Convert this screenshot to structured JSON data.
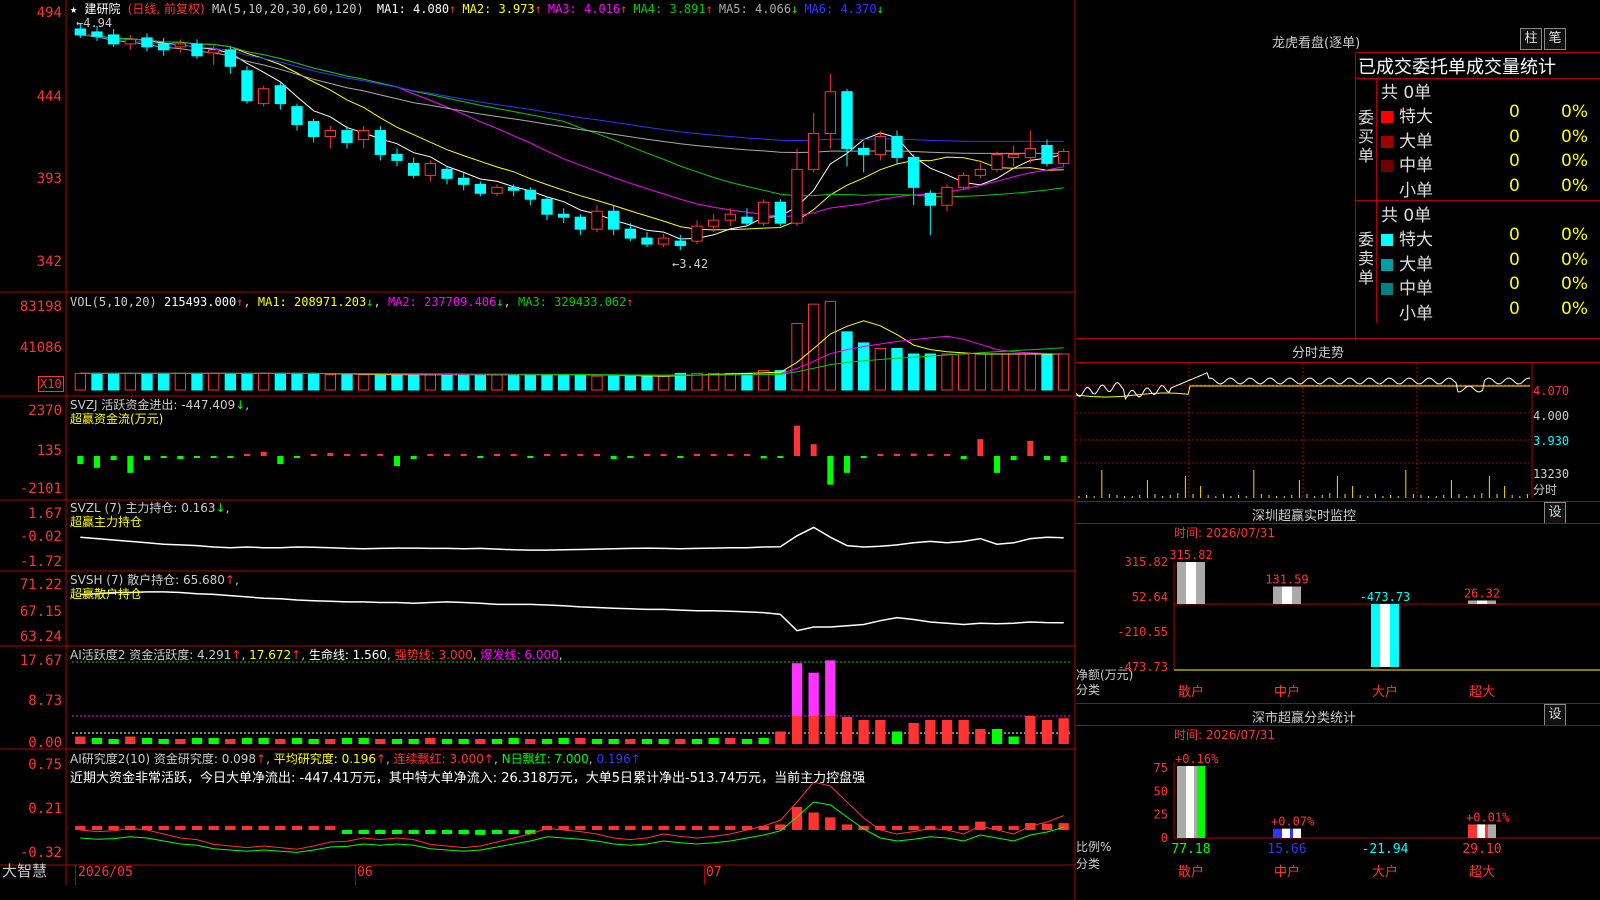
{
  "stock": {
    "name": "建研院",
    "period_note": "(日线, 前复权)"
  },
  "colors": {
    "up": "#ff3333",
    "down": "#00ffff",
    "ma1": "#ffffff",
    "ma2": "#ffff00",
    "ma3": "#ff00ff",
    "ma4": "#00cc00",
    "ma5": "#aaaaaa",
    "ma6": "#3333ff",
    "border": "#b00000",
    "green_bar": "#00ff00",
    "gold": "#ffd700"
  },
  "main_panel": {
    "ma_header": "MA(5,10,20,30,60,120)",
    "ma_values": [
      {
        "label": "MA1: 4.080",
        "arrow": "↑",
        "color": "#ffffff"
      },
      {
        "label": "MA2: 3.973",
        "arrow": "↑",
        "color": "#ffff00"
      },
      {
        "label": "MA3: 4.016",
        "arrow": "↑",
        "color": "#ff00ff"
      },
      {
        "label": "MA4: 3.891",
        "arrow": "↑",
        "color": "#00cc00"
      },
      {
        "label": "MA5: 4.066",
        "arrow": "↓",
        "color": "#aaaaaa"
      },
      {
        "label": "MA6: 4.370",
        "arrow": "↓",
        "color": "#3333ff"
      }
    ],
    "y_ticks": [
      "494",
      "444",
      "393",
      "342"
    ],
    "high_label": "4.94",
    "low_label": "3.42"
  },
  "vol_panel": {
    "header": "VOL(5,10,20)",
    "value": "215493.000",
    "ma1": "MA1: 208971.203",
    "ma2": "MA2: 237709.406",
    "ma3": "MA3: 329433.062",
    "y_ticks": [
      "83198",
      "41086"
    ],
    "unit": "X10"
  },
  "svzj_panel": {
    "header": "SVZJ  活跃资金进出: -447.409",
    "subtitle": "超赢资金流(万元)",
    "y_ticks": [
      "2370",
      "135",
      "-2101"
    ]
  },
  "svzl_panel": {
    "header": "SVZL (7) 主力持仓: 0.163",
    "subtitle": "超赢主力持仓",
    "y_ticks": [
      "1.67",
      "-0.02",
      "-1.72"
    ]
  },
  "svsh_panel": {
    "header": "SVSH (7) 散户持仓: 65.680",
    "subtitle": "超赢散户持仓",
    "y_ticks": [
      "71.22",
      "67.15",
      "63.24"
    ]
  },
  "ai1_panel": {
    "header_a": "AI活跃度2 资金活跃度: 4.291",
    "header_b": "17.672",
    "header_c": "生命线: 1.560",
    "header_d": "强势线: 3.000",
    "header_e": "爆发线: 6.000",
    "y_ticks": [
      "17.67",
      "8.73",
      "0.00"
    ]
  },
  "ai2_panel": {
    "header_a": "AI研究度2(10) 资金研究度: 0.098",
    "header_b": "平均研究度: 0.196",
    "header_c": "连续飘红: 3.000",
    "header_d": "N日飘红: 7.000",
    "header_e": "0.196",
    "note": "近期大资金非常活跃，今日大单净流出: -447.41万元，其中特大单净流入: 26.318万元，大单5日累计净出-513.74万元，当前主力控盘强",
    "y_ticks": [
      "0.75",
      "0.21",
      "-0.32"
    ]
  },
  "x_axis": {
    "labels": [
      "2026/05",
      "06",
      "07"
    ],
    "brand": "大智慧"
  },
  "dragon_tiger": {
    "title": "龙虎看盘(逐单)",
    "tab1": "柱",
    "tab2": "笔",
    "section_title": "已成交委托单成交量统计",
    "buy_label": "委买单",
    "sell_label": "委卖单",
    "buy_total": "共 0单",
    "sell_total": "共 0单",
    "buy_rows": [
      {
        "label": "特大",
        "count": "0",
        "pct": "0%",
        "color": "#ff0000"
      },
      {
        "label": "大单",
        "count": "0",
        "pct": "0%",
        "color": "#a00000"
      },
      {
        "label": "中单",
        "count": "0",
        "pct": "0%",
        "color": "#700000"
      },
      {
        "label": "小单",
        "count": "0",
        "pct": "0%",
        "color": ""
      }
    ],
    "sell_rows": [
      {
        "label": "特大",
        "count": "0",
        "pct": "0%",
        "color": "#00ffff"
      },
      {
        "label": "大单",
        "count": "0",
        "pct": "0%",
        "color": "#00a0a0"
      },
      {
        "label": "中单",
        "count": "0",
        "pct": "0%",
        "color": "#008080"
      },
      {
        "label": "小单",
        "count": "0",
        "pct": "0%",
        "color": ""
      }
    ]
  },
  "intraday": {
    "title": "分时走势",
    "y_labels": [
      "4.070",
      "4.000",
      "3.930"
    ],
    "vol_label": "13230",
    "vol_unit": "分时"
  },
  "sz_monitor": {
    "title": "深圳超赢实时监控",
    "settings": "设",
    "time": "时间: 2026/07/31",
    "y_ticks": [
      "315.82",
      "52.64",
      "-210.55",
      "-473.73"
    ],
    "y_axis_title": "净额(万元)",
    "x_axis_title": "分类",
    "categories": [
      "散户",
      "中户",
      "大户",
      "超大"
    ],
    "values": [
      315.82,
      131.59,
      -473.73,
      26.32
    ],
    "value_labels": [
      "315.82",
      "131.59",
      "-473.73",
      "26.32"
    ]
  },
  "sz_stats": {
    "title": "深市超赢分类统计",
    "settings": "设",
    "time": "时间: 2026/07/31",
    "y_ticks": [
      "75",
      "50",
      "25",
      "0"
    ],
    "y_axis_title": "比例%",
    "x_axis_title": "分类",
    "categories": [
      "散户",
      "中户",
      "大户",
      "超大"
    ],
    "pct_labels": [
      "+0.16%",
      "+0.07%",
      "",
      "+0.01%"
    ],
    "bar_values": [
      77.18,
      15.66,
      0,
      29.1
    ],
    "bottom_values": [
      "77.18",
      "15.66",
      "-21.94",
      "29.10"
    ]
  },
  "chart_data": [
    {
      "type": "candlestick",
      "title": "建研院 (日线, 前复权)",
      "ylim": [
        3.3,
        5.0
      ],
      "candles": [
        [
          4.9,
          4.86,
          4.94,
          4.84
        ],
        [
          4.88,
          4.85,
          4.92,
          4.82
        ],
        [
          4.86,
          4.8,
          4.9,
          4.78
        ],
        [
          4.8,
          4.83,
          4.86,
          4.76
        ],
        [
          4.84,
          4.78,
          4.87,
          4.75
        ],
        [
          4.8,
          4.76,
          4.84,
          4.72
        ],
        [
          4.78,
          4.8,
          4.83,
          4.74
        ],
        [
          4.8,
          4.72,
          4.83,
          4.7
        ],
        [
          4.74,
          4.76,
          4.79,
          4.66
        ],
        [
          4.76,
          4.65,
          4.78,
          4.6
        ],
        [
          4.62,
          4.42,
          4.65,
          4.4
        ],
        [
          4.4,
          4.5,
          4.52,
          4.38
        ],
        [
          4.52,
          4.4,
          4.54,
          4.36
        ],
        [
          4.38,
          4.26,
          4.4,
          4.22
        ],
        [
          4.28,
          4.18,
          4.3,
          4.14
        ],
        [
          4.18,
          4.22,
          4.25,
          4.1
        ],
        [
          4.22,
          4.14,
          4.25,
          4.1
        ],
        [
          4.16,
          4.22,
          4.25,
          4.1
        ],
        [
          4.22,
          4.06,
          4.25,
          4.02
        ],
        [
          4.06,
          4.02,
          4.1,
          3.98
        ],
        [
          4.0,
          3.92,
          4.04,
          3.9
        ],
        [
          3.92,
          4.0,
          4.02,
          3.88
        ],
        [
          3.96,
          3.9,
          3.98,
          3.86
        ],
        [
          3.9,
          3.86,
          3.94,
          3.82
        ],
        [
          3.86,
          3.8,
          3.88,
          3.78
        ],
        [
          3.8,
          3.84,
          3.86,
          3.78
        ],
        [
          3.84,
          3.82,
          3.86,
          3.78
        ],
        [
          3.82,
          3.76,
          3.84,
          3.72
        ],
        [
          3.76,
          3.66,
          3.78,
          3.62
        ],
        [
          3.66,
          3.64,
          3.7,
          3.6
        ],
        [
          3.64,
          3.56,
          3.66,
          3.52
        ],
        [
          3.56,
          3.68,
          3.72,
          3.54
        ],
        [
          3.68,
          3.56,
          3.72,
          3.52
        ],
        [
          3.56,
          3.5,
          3.6,
          3.48
        ],
        [
          3.5,
          3.46,
          3.54,
          3.44
        ],
        [
          3.46,
          3.5,
          3.53,
          3.44
        ],
        [
          3.48,
          3.45,
          3.52,
          3.42
        ],
        [
          3.48,
          3.58,
          3.62,
          3.46
        ],
        [
          3.58,
          3.62,
          3.66,
          3.54
        ],
        [
          3.62,
          3.66,
          3.7,
          3.58
        ],
        [
          3.64,
          3.6,
          3.7,
          3.58
        ],
        [
          3.6,
          3.74,
          3.76,
          3.58
        ],
        [
          3.74,
          3.6,
          3.76,
          3.58
        ],
        [
          3.6,
          3.96,
          4.1,
          3.58
        ],
        [
          3.96,
          4.2,
          4.34,
          3.94
        ],
        [
          4.2,
          4.48,
          4.6,
          4.1
        ],
        [
          4.48,
          4.1,
          4.5,
          3.98
        ],
        [
          4.1,
          4.06,
          4.14,
          3.94
        ],
        [
          4.06,
          4.18,
          4.22,
          4.02
        ],
        [
          4.18,
          4.04,
          4.22,
          4.0
        ],
        [
          4.04,
          3.84,
          4.06,
          3.72
        ],
        [
          3.8,
          3.72,
          3.82,
          3.52
        ],
        [
          3.72,
          3.84,
          3.86,
          3.68
        ],
        [
          3.84,
          3.92,
          3.94,
          3.82
        ],
        [
          3.92,
          3.96,
          4.0,
          3.9
        ],
        [
          3.96,
          4.06,
          4.08,
          3.94
        ],
        [
          4.04,
          4.06,
          4.12,
          3.98
        ],
        [
          4.04,
          4.1,
          4.22,
          4.0
        ],
        [
          4.12,
          4.0,
          4.16,
          3.98
        ],
        [
          4.0,
          4.08,
          4.1,
          3.98
        ]
      ],
      "ma_series": {
        "MA1": 4.08,
        "MA2": 3.973,
        "MA3": 4.016,
        "MA4": 3.891,
        "MA5": 4.066,
        "MA6": 4.37
      }
    },
    {
      "type": "bar",
      "title": "VOL(5,10,20)",
      "ylim": [
        0,
        83198
      ],
      "values": [
        12,
        12,
        12,
        12,
        12,
        12,
        12,
        12,
        12,
        12,
        12,
        12,
        12,
        12,
        12,
        11,
        11,
        11,
        11,
        11,
        11,
        11,
        11,
        11,
        11,
        11,
        11,
        11,
        11,
        11,
        11,
        10,
        10,
        10,
        10,
        10,
        12,
        12,
        12,
        12,
        12,
        14,
        14,
        48,
        62,
        64,
        42,
        34,
        30,
        30,
        26,
        26,
        26,
        26,
        26,
        26,
        26,
        26,
        26,
        26
      ],
      "up": [
        1,
        0,
        0,
        1,
        0,
        0,
        1,
        0,
        1,
        0,
        0,
        1,
        0,
        0,
        0,
        1,
        0,
        1,
        0,
        0,
        0,
        1,
        0,
        0,
        0,
        1,
        0,
        0,
        0,
        0,
        0,
        1,
        0,
        0,
        0,
        1,
        0,
        1,
        1,
        1,
        0,
        1,
        0,
        1,
        1,
        1,
        0,
        0,
        1,
        0,
        0,
        0,
        1,
        1,
        1,
        1,
        1,
        1,
        0,
        1
      ],
      "series": [
        {
          "name": "MA1",
          "last": 208971.203
        },
        {
          "name": "MA2",
          "last": 237709.406
        },
        {
          "name": "MA3",
          "last": 329433.062
        }
      ]
    },
    {
      "type": "bar",
      "title": "超赢资金流(万元)",
      "ylim": [
        -2101,
        2370
      ],
      "values": [
        -400,
        -700,
        -200,
        -1000,
        -200,
        -100,
        -150,
        -100,
        -50,
        -50,
        80,
        200,
        -400,
        -100,
        100,
        150,
        80,
        30,
        50,
        -500,
        -150,
        80,
        50,
        30,
        -50,
        100,
        80,
        -100,
        60,
        70,
        100,
        60,
        -150,
        -100,
        80,
        60,
        -80,
        50,
        60,
        50,
        30,
        -120,
        -80,
        1800,
        700,
        -1700,
        -1000,
        -100,
        60,
        80,
        120,
        100,
        80,
        -150,
        1000,
        -1000,
        -200,
        900,
        -200,
        -300
      ]
    },
    {
      "type": "line",
      "title": "超赢主力持仓",
      "ylim": [
        -1.72,
        1.67
      ],
      "values": [
        0.2,
        0.1,
        0.0,
        -0.1,
        -0.2,
        -0.3,
        -0.35,
        -0.4,
        -0.5,
        -0.55,
        -0.5,
        -0.55,
        -0.55,
        -0.5,
        -0.52,
        -0.55,
        -0.6,
        -0.62,
        -0.6,
        -0.58,
        -0.58,
        -0.6,
        -0.6,
        -0.62,
        -0.6,
        -0.65,
        -0.7,
        -0.72,
        -0.72,
        -0.7,
        -0.68,
        -0.65,
        -0.62,
        -0.6,
        -0.58,
        -0.6,
        -0.62,
        -0.6,
        -0.58,
        -0.56,
        -0.55,
        -0.5,
        -0.48,
        0.3,
        0.9,
        0.2,
        -0.4,
        -0.5,
        -0.45,
        -0.35,
        -0.2,
        -0.1,
        -0.2,
        -0.1,
        0.1,
        -0.3,
        -0.2,
        0.1,
        0.2,
        0.16
      ]
    },
    {
      "type": "line",
      "title": "超赢散户持仓",
      "ylim": [
        63.24,
        71.22
      ],
      "values": [
        70.2,
        70.3,
        70.5,
        70.5,
        70.6,
        70.6,
        70.5,
        70.3,
        70.2,
        70.0,
        69.8,
        69.6,
        69.5,
        69.3,
        69.2,
        69.1,
        69.0,
        69.0,
        68.9,
        68.9,
        68.8,
        68.9,
        69.0,
        68.9,
        68.8,
        68.6,
        68.6,
        68.6,
        68.5,
        68.4,
        68.2,
        68.1,
        68.0,
        67.9,
        67.8,
        67.8,
        67.7,
        67.6,
        67.6,
        67.5,
        67.4,
        67.3,
        67.0,
        64.4,
        65.0,
        65.0,
        65.2,
        65.4,
        66.0,
        66.5,
        66.2,
        65.8,
        65.6,
        65.4,
        65.6,
        65.5,
        65.6,
        65.8,
        65.7,
        65.68
      ]
    },
    {
      "type": "bar",
      "title": "AI活跃度2",
      "ylim": [
        0,
        17.67
      ],
      "values": [
        1.5,
        1.2,
        0.8,
        1.5,
        1.2,
        1.0,
        1.0,
        1.2,
        1.2,
        1.0,
        1.2,
        1.2,
        1.0,
        1.2,
        1.0,
        1.0,
        1.2,
        1.2,
        1.0,
        1.0,
        1.0,
        1.2,
        1.0,
        1.0,
        1.0,
        1.0,
        1.2,
        1.0,
        1.0,
        1.2,
        1.2,
        1.0,
        1.0,
        1.0,
        1.0,
        1.0,
        1.0,
        1.0,
        1.2,
        1.2,
        1.0,
        1.2,
        2.5,
        17.0,
        15.0,
        17.6,
        4.5,
        4.0,
        4.0,
        2.5,
        3.5,
        4.0,
        4.0,
        4.0,
        3.0,
        3.0,
        1.5,
        6.0,
        4.0,
        4.3
      ]
    },
    {
      "type": "bar",
      "title": "AI研究度2(10)",
      "ylim": [
        -0.32,
        0.75
      ],
      "values": [
        0.02,
        0.03,
        0.05,
        0.06,
        0.05,
        0.04,
        0.04,
        0.05,
        0.05,
        0.04,
        0.03,
        0.04,
        0.05,
        0.06,
        0.05,
        0.04,
        -0.02,
        -0.03,
        -0.03,
        -0.04,
        -0.05,
        -0.04,
        -0.04,
        -0.06,
        -0.07,
        -0.05,
        -0.04,
        -0.03,
        0.02,
        0.03,
        0.04,
        0.02,
        0.03,
        0.04,
        0.05,
        0.06,
        0.04,
        0.03,
        0.03,
        0.04,
        0.05,
        0.03,
        0.08,
        0.33,
        0.25,
        0.18,
        0.08,
        0.05,
        0.04,
        0.04,
        0.03,
        0.03,
        0.03,
        0.06,
        0.12,
        0.06,
        0.02,
        0.1,
        0.09,
        0.098
      ]
    }
  ]
}
